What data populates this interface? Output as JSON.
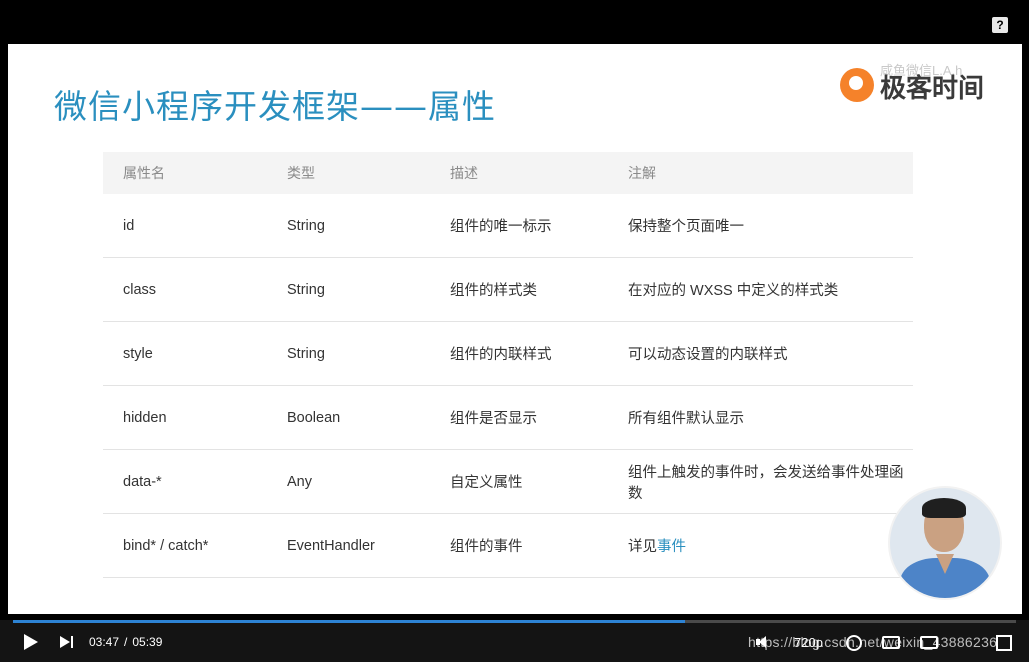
{
  "help_icon": "?",
  "slide": {
    "title": "微信小程序开发框架——属性",
    "logo_text": "极客时间",
    "logo_overlay": "咸鱼微信L.A.h"
  },
  "table": {
    "headers": [
      "属性名",
      "类型",
      "描述",
      "注解"
    ],
    "rows": [
      {
        "name": "id",
        "type": "String",
        "desc": "组件的唯一标示",
        "note": "保持整个页面唯一"
      },
      {
        "name": "class",
        "type": "String",
        "desc": "组件的样式类",
        "note": "在对应的 WXSS 中定义的样式类"
      },
      {
        "name": "style",
        "type": "String",
        "desc": "组件的内联样式",
        "note": "可以动态设置的内联样式"
      },
      {
        "name": "hidden",
        "type": "Boolean",
        "desc": "组件是否显示",
        "note": "所有组件默认显示"
      },
      {
        "name": "data-*",
        "type": "Any",
        "desc": "自定义属性",
        "note": "组件上触发的事件时，会发送给事件处理函数"
      },
      {
        "name": "bind* / catch*",
        "type": "EventHandler",
        "desc": "组件的事件",
        "note_prefix": "详见",
        "note_link": "事件"
      }
    ]
  },
  "player": {
    "current_time": "03:47",
    "separator": "/",
    "duration": "05:39",
    "progress_fraction": 0.67,
    "watermark": "https://blog.csdn.net/weixin_43886236",
    "quality": "720p",
    "accent_color": "#2d83d4",
    "icons": [
      "play-icon",
      "next-icon",
      "volume-icon",
      "settings-icon",
      "captions-icon",
      "pip-icon",
      "fullscreen-icon",
      "help-icon"
    ]
  }
}
